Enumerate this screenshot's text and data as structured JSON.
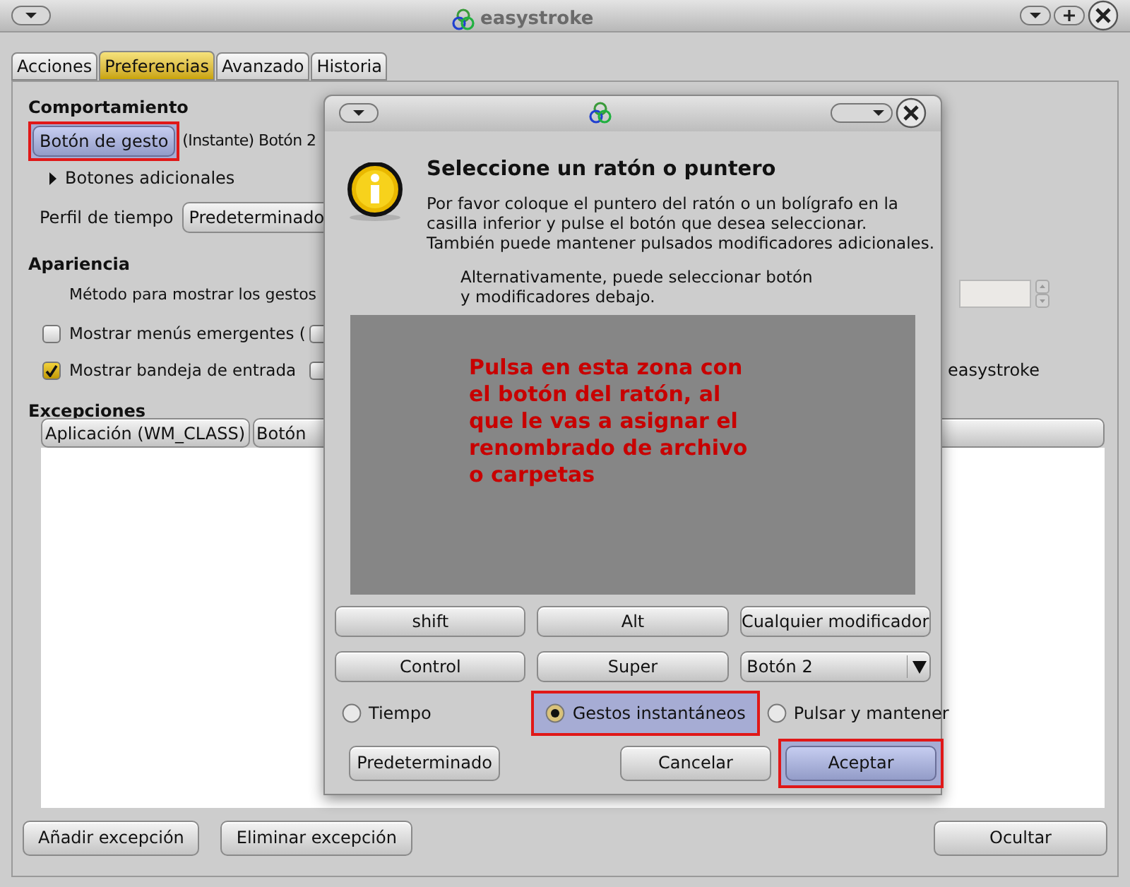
{
  "window": {
    "title": "easystroke"
  },
  "tabs": [
    {
      "label": "Acciones",
      "selected": false
    },
    {
      "label": "Preferencias",
      "selected": true
    },
    {
      "label": "Avanzado",
      "selected": false
    },
    {
      "label": "Historia",
      "selected": false
    }
  ],
  "behavior": {
    "heading": "Comportamiento",
    "gesture_button": {
      "label": "Botón de gesto",
      "highlighted": true
    },
    "gesture_value": "(Instante) Botón 2",
    "additional_buttons": {
      "label": "Botones adicionales",
      "expanded": false
    },
    "timing_profile": {
      "label": "Perfil de tiempo",
      "value": "Predeterminado"
    }
  },
  "appearance": {
    "heading": "Apariencia",
    "method_label": "Método para mostrar los gestos",
    "checkboxes": [
      {
        "label": "Mostrar menús emergentes (",
        "checked": false,
        "extra_checked": false
      },
      {
        "label": "Mostrar bandeja de entrada",
        "checked": true,
        "extra_checked": false,
        "suffix": "easystroke"
      }
    ]
  },
  "exceptions": {
    "heading": "Excepciones",
    "columns": [
      "Aplicación (WM_CLASS)",
      "Botón"
    ]
  },
  "buttons": [
    "Añadir excepción",
    "Eliminar excepción",
    "Ocultar"
  ],
  "dialog": {
    "title": "Seleccione un ratón o puntero",
    "message": "Por favor coloque el puntero del ratón o un bolígrafo en la casilla inferior y pulse el botón que desea seleccionar. También puede mantener pulsados modificadores adicionales.",
    "alternative": "Alternativamente, puede seleccionar botón y modificadores debajo.",
    "area_note": "Pulsa en esta zona con el botón del ratón, al que le vas a asignar el renombrado de archivo o carpetas",
    "modifiers": [
      "shift",
      "Alt",
      "Cualquier modificador",
      "Control",
      "Super"
    ],
    "button_combo": "Botón 2",
    "modes": [
      {
        "label": "Tiempo",
        "selected": false,
        "highlighted": false
      },
      {
        "label": "Gestos instantáneos",
        "selected": true,
        "highlighted": true
      },
      {
        "label": "Pulsar y mantener",
        "selected": false,
        "highlighted": false
      }
    ],
    "actions": [
      {
        "label": "Predeterminado",
        "highlighted": false
      },
      {
        "label": "Cancelar",
        "highlighted": false
      },
      {
        "label": "Aceptar",
        "highlighted": true
      }
    ]
  }
}
